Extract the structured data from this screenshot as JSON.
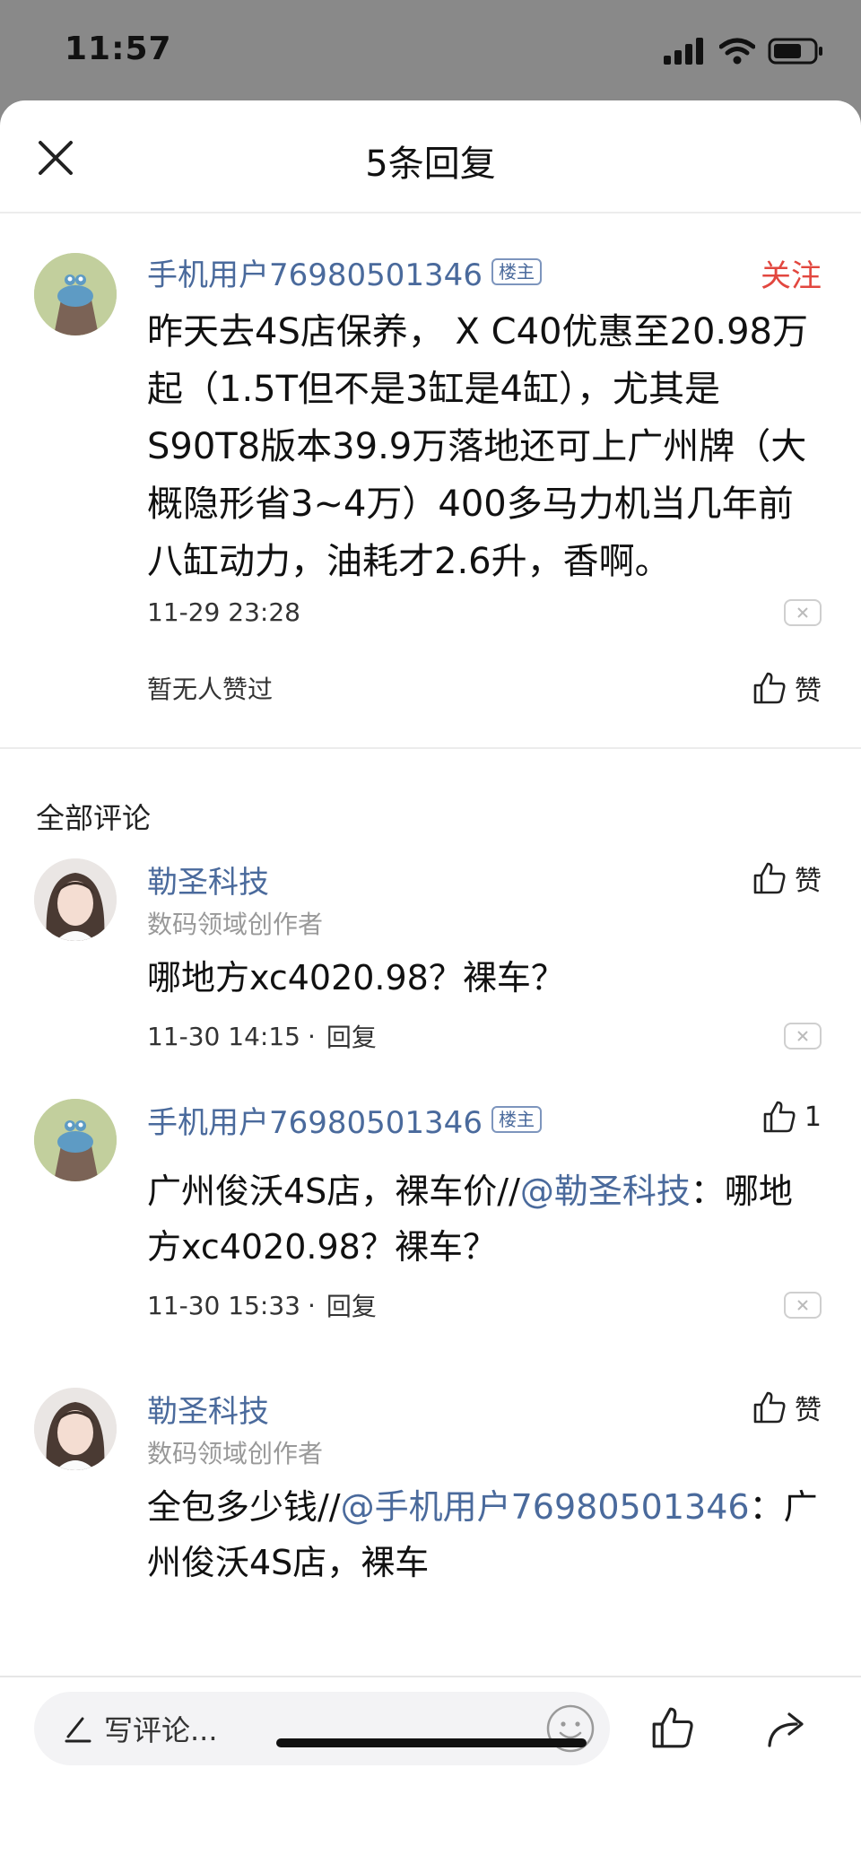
{
  "status_bar": {
    "time": "11:57"
  },
  "header": {
    "title": "5条回复"
  },
  "post": {
    "username": "手机用户76980501346",
    "badge": "楼主",
    "follow_label": "关注",
    "body": "昨天去4S店保养， X C40优惠至20.98万起（1.5T但不是3缸是4缸），尤其是S90T8版本39.9万落地还可上广州牌（大概隐形省3~4万）400多马力机当几年前八缸动力，油耗才2.6升，香啊。",
    "timestamp": "11-29 23:28",
    "no_likes_text": "暂无人赞过",
    "like_label": "赞"
  },
  "section_label": "全部评论",
  "comments": [
    {
      "username": "勒圣科技",
      "subtitle": "数码领域创作者",
      "like_label": "赞",
      "body": "哪地方xc4020.98？裸车？",
      "timestamp": "11-30 14:15",
      "separator": "·",
      "reply_label": "回复"
    },
    {
      "username": "手机用户76980501346",
      "badge": "楼主",
      "like_count": "1",
      "body_prefix": "广州俊沃4S店，裸车价//",
      "mention": "@勒圣科技",
      "body_suffix": "：哪地方xc4020.98？裸车？",
      "timestamp": "11-30 15:33",
      "separator": "·",
      "reply_label": "回复"
    },
    {
      "username": "勒圣科技",
      "subtitle": "数码领域创作者",
      "like_label": "赞",
      "body_prefix": "全包多少钱//",
      "mention": "@手机用户76980501346",
      "body_suffix": "：广州俊沃4S店，裸车"
    }
  ],
  "bottom_bar": {
    "input_placeholder": "写评论..."
  }
}
